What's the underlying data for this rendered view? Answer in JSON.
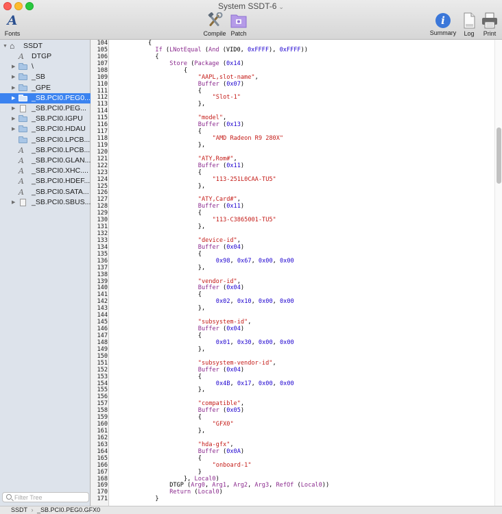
{
  "window": {
    "title": "System SSDT-6"
  },
  "toolbar": {
    "fonts_label": "Fonts",
    "compile_label": "Compile",
    "patch_label": "Patch",
    "summary_label": "Summary",
    "log_label": "Log",
    "print_label": "Print"
  },
  "sidebar": {
    "root": "SSDT",
    "items": [
      {
        "label": "DTGP",
        "icon": "method-icon",
        "disclosure": false
      },
      {
        "label": "\\",
        "icon": "folder-icon",
        "disclosure": true
      },
      {
        "label": "_SB",
        "icon": "folder-icon",
        "disclosure": true
      },
      {
        "label": "_GPE",
        "icon": "folder-icon",
        "disclosure": true
      },
      {
        "label": "_SB.PCI0.PEG0...",
        "icon": "folder-icon",
        "disclosure": true,
        "selected": true
      },
      {
        "label": "_SB.PCI0.PEG...",
        "icon": "device-icon",
        "disclosure": true
      },
      {
        "label": "_SB.PCI0.IGPU",
        "icon": "folder-icon",
        "disclosure": true
      },
      {
        "label": "_SB.PCI0.HDAU",
        "icon": "folder-icon",
        "disclosure": true
      },
      {
        "label": "_SB.PCI0.LPCB...",
        "icon": "folder-icon",
        "disclosure": false
      },
      {
        "label": "_SB.PCI0.LPCB...",
        "icon": "method-icon",
        "disclosure": false
      },
      {
        "label": "_SB.PCI0.GLAN...",
        "icon": "method-icon",
        "disclosure": false
      },
      {
        "label": "_SB.PCI0.XHC....",
        "icon": "method-icon",
        "disclosure": false
      },
      {
        "label": "_SB.PCI0.HDEF...",
        "icon": "method-icon",
        "disclosure": false
      },
      {
        "label": "_SB.PCI0.SATA...",
        "icon": "method-icon",
        "disclosure": false
      },
      {
        "label": "_SB.PCI0.SBUS...",
        "icon": "device-icon",
        "disclosure": true
      }
    ],
    "filter_placeholder": "Filter Tree"
  },
  "editor": {
    "lines": [
      {
        "n": "104",
        "indent": 10,
        "tokens": [
          [
            "p",
            "{"
          ]
        ]
      },
      {
        "n": "105",
        "indent": 12,
        "tokens": [
          [
            "k",
            "If"
          ],
          [
            "p",
            " ("
          ],
          [
            "k",
            "LNotEqual"
          ],
          [
            "p",
            " ("
          ],
          [
            "k",
            "And"
          ],
          [
            "p",
            " (VID0, "
          ],
          [
            "n",
            "0xFFFF"
          ],
          [
            "p",
            "), "
          ],
          [
            "n",
            "0xFFFF"
          ],
          [
            "p",
            "))"
          ]
        ]
      },
      {
        "n": "106",
        "indent": 12,
        "tokens": [
          [
            "p",
            "{"
          ]
        ]
      },
      {
        "n": "107",
        "indent": 16,
        "tokens": [
          [
            "k",
            "Store"
          ],
          [
            "p",
            " ("
          ],
          [
            "k",
            "Package"
          ],
          [
            "p",
            " ("
          ],
          [
            "n",
            "0x14"
          ],
          [
            "p",
            ")"
          ]
        ]
      },
      {
        "n": "108",
        "indent": 20,
        "tokens": [
          [
            "p",
            "{"
          ]
        ]
      },
      {
        "n": "109",
        "indent": 24,
        "tokens": [
          [
            "s",
            "\"AAPL,slot-name\""
          ],
          [
            "p",
            ","
          ]
        ]
      },
      {
        "n": "110",
        "indent": 24,
        "tokens": [
          [
            "k",
            "Buffer"
          ],
          [
            "p",
            " ("
          ],
          [
            "n",
            "0x07"
          ],
          [
            "p",
            ")"
          ]
        ]
      },
      {
        "n": "111",
        "indent": 24,
        "tokens": [
          [
            "p",
            "{"
          ]
        ]
      },
      {
        "n": "112",
        "indent": 28,
        "tokens": [
          [
            "s",
            "\"Slot-1\""
          ]
        ]
      },
      {
        "n": "113",
        "indent": 24,
        "tokens": [
          [
            "p",
            "},"
          ]
        ]
      },
      {
        "n": "114",
        "indent": 0,
        "tokens": []
      },
      {
        "n": "115",
        "indent": 24,
        "tokens": [
          [
            "s",
            "\"model\""
          ],
          [
            "p",
            ","
          ]
        ]
      },
      {
        "n": "116",
        "indent": 24,
        "tokens": [
          [
            "k",
            "Buffer"
          ],
          [
            "p",
            " ("
          ],
          [
            "n",
            "0x13"
          ],
          [
            "p",
            ")"
          ]
        ]
      },
      {
        "n": "117",
        "indent": 24,
        "tokens": [
          [
            "p",
            "{"
          ]
        ]
      },
      {
        "n": "118",
        "indent": 28,
        "tokens": [
          [
            "s",
            "\"AMD Radeon R9 280X\""
          ]
        ]
      },
      {
        "n": "119",
        "indent": 24,
        "tokens": [
          [
            "p",
            "},"
          ]
        ]
      },
      {
        "n": "120",
        "indent": 0,
        "tokens": []
      },
      {
        "n": "121",
        "indent": 24,
        "tokens": [
          [
            "s",
            "\"ATY,Rom#\""
          ],
          [
            "p",
            ","
          ]
        ]
      },
      {
        "n": "122",
        "indent": 24,
        "tokens": [
          [
            "k",
            "Buffer"
          ],
          [
            "p",
            " ("
          ],
          [
            "n",
            "0x11"
          ],
          [
            "p",
            ")"
          ]
        ]
      },
      {
        "n": "123",
        "indent": 24,
        "tokens": [
          [
            "p",
            "{"
          ]
        ]
      },
      {
        "n": "124",
        "indent": 28,
        "tokens": [
          [
            "s",
            "\"113-251L0CAA-TU5\""
          ]
        ]
      },
      {
        "n": "125",
        "indent": 24,
        "tokens": [
          [
            "p",
            "},"
          ]
        ]
      },
      {
        "n": "126",
        "indent": 0,
        "tokens": []
      },
      {
        "n": "127",
        "indent": 24,
        "tokens": [
          [
            "s",
            "\"ATY,Card#\""
          ],
          [
            "p",
            ","
          ]
        ]
      },
      {
        "n": "128",
        "indent": 24,
        "tokens": [
          [
            "k",
            "Buffer"
          ],
          [
            "p",
            " ("
          ],
          [
            "n",
            "0x11"
          ],
          [
            "p",
            ")"
          ]
        ]
      },
      {
        "n": "129",
        "indent": 24,
        "tokens": [
          [
            "p",
            "{"
          ]
        ]
      },
      {
        "n": "130",
        "indent": 28,
        "tokens": [
          [
            "s",
            "\"113-C3865001-TU5\""
          ]
        ]
      },
      {
        "n": "131",
        "indent": 24,
        "tokens": [
          [
            "p",
            "},"
          ]
        ]
      },
      {
        "n": "132",
        "indent": 0,
        "tokens": []
      },
      {
        "n": "133",
        "indent": 24,
        "tokens": [
          [
            "s",
            "\"device-id\""
          ],
          [
            "p",
            ","
          ]
        ]
      },
      {
        "n": "134",
        "indent": 24,
        "tokens": [
          [
            "k",
            "Buffer"
          ],
          [
            "p",
            " ("
          ],
          [
            "n",
            "0x04"
          ],
          [
            "p",
            ")"
          ]
        ]
      },
      {
        "n": "135",
        "indent": 24,
        "tokens": [
          [
            "p",
            "{"
          ]
        ]
      },
      {
        "n": "136",
        "indent": 29,
        "tokens": [
          [
            "n",
            "0x98"
          ],
          [
            "p",
            ", "
          ],
          [
            "n",
            "0x67"
          ],
          [
            "p",
            ", "
          ],
          [
            "n",
            "0x00"
          ],
          [
            "p",
            ", "
          ],
          [
            "n",
            "0x00"
          ]
        ]
      },
      {
        "n": "137",
        "indent": 24,
        "tokens": [
          [
            "p",
            "},"
          ]
        ]
      },
      {
        "n": "138",
        "indent": 0,
        "tokens": []
      },
      {
        "n": "139",
        "indent": 24,
        "tokens": [
          [
            "s",
            "\"vendor-id\""
          ],
          [
            "p",
            ","
          ]
        ]
      },
      {
        "n": "140",
        "indent": 24,
        "tokens": [
          [
            "k",
            "Buffer"
          ],
          [
            "p",
            " ("
          ],
          [
            "n",
            "0x04"
          ],
          [
            "p",
            ")"
          ]
        ]
      },
      {
        "n": "141",
        "indent": 24,
        "tokens": [
          [
            "p",
            "{"
          ]
        ]
      },
      {
        "n": "142",
        "indent": 29,
        "tokens": [
          [
            "n",
            "0x02"
          ],
          [
            "p",
            ", "
          ],
          [
            "n",
            "0x10"
          ],
          [
            "p",
            ", "
          ],
          [
            "n",
            "0x00"
          ],
          [
            "p",
            ", "
          ],
          [
            "n",
            "0x00"
          ]
        ]
      },
      {
        "n": "143",
        "indent": 24,
        "tokens": [
          [
            "p",
            "},"
          ]
        ]
      },
      {
        "n": "144",
        "indent": 0,
        "tokens": []
      },
      {
        "n": "145",
        "indent": 24,
        "tokens": [
          [
            "s",
            "\"subsystem-id\""
          ],
          [
            "p",
            ","
          ]
        ]
      },
      {
        "n": "146",
        "indent": 24,
        "tokens": [
          [
            "k",
            "Buffer"
          ],
          [
            "p",
            " ("
          ],
          [
            "n",
            "0x04"
          ],
          [
            "p",
            ")"
          ]
        ]
      },
      {
        "n": "147",
        "indent": 24,
        "tokens": [
          [
            "p",
            "{"
          ]
        ]
      },
      {
        "n": "148",
        "indent": 29,
        "tokens": [
          [
            "n",
            "0x01"
          ],
          [
            "p",
            ", "
          ],
          [
            "n",
            "0x30"
          ],
          [
            "p",
            ", "
          ],
          [
            "n",
            "0x00"
          ],
          [
            "p",
            ", "
          ],
          [
            "n",
            "0x00"
          ]
        ]
      },
      {
        "n": "149",
        "indent": 24,
        "tokens": [
          [
            "p",
            "},"
          ]
        ]
      },
      {
        "n": "150",
        "indent": 0,
        "tokens": []
      },
      {
        "n": "151",
        "indent": 24,
        "tokens": [
          [
            "s",
            "\"subsystem-vendor-id\""
          ],
          [
            "p",
            ","
          ]
        ]
      },
      {
        "n": "152",
        "indent": 24,
        "tokens": [
          [
            "k",
            "Buffer"
          ],
          [
            "p",
            " ("
          ],
          [
            "n",
            "0x04"
          ],
          [
            "p",
            ")"
          ]
        ]
      },
      {
        "n": "153",
        "indent": 24,
        "tokens": [
          [
            "p",
            "{"
          ]
        ]
      },
      {
        "n": "154",
        "indent": 29,
        "tokens": [
          [
            "n",
            "0x4B"
          ],
          [
            "p",
            ", "
          ],
          [
            "n",
            "0x17"
          ],
          [
            "p",
            ", "
          ],
          [
            "n",
            "0x00"
          ],
          [
            "p",
            ", "
          ],
          [
            "n",
            "0x00"
          ]
        ]
      },
      {
        "n": "155",
        "indent": 24,
        "tokens": [
          [
            "p",
            "},"
          ]
        ]
      },
      {
        "n": "156",
        "indent": 0,
        "tokens": []
      },
      {
        "n": "157",
        "indent": 24,
        "tokens": [
          [
            "s",
            "\"compatible\""
          ],
          [
            "p",
            ","
          ]
        ]
      },
      {
        "n": "158",
        "indent": 24,
        "tokens": [
          [
            "k",
            "Buffer"
          ],
          [
            "p",
            " ("
          ],
          [
            "n",
            "0x05"
          ],
          [
            "p",
            ")"
          ]
        ]
      },
      {
        "n": "159",
        "indent": 24,
        "tokens": [
          [
            "p",
            "{"
          ]
        ]
      },
      {
        "n": "160",
        "indent": 28,
        "tokens": [
          [
            "s",
            "\"GFX0\""
          ]
        ]
      },
      {
        "n": "161",
        "indent": 24,
        "tokens": [
          [
            "p",
            "},"
          ]
        ]
      },
      {
        "n": "162",
        "indent": 0,
        "tokens": []
      },
      {
        "n": "163",
        "indent": 24,
        "tokens": [
          [
            "s",
            "\"hda-gfx\""
          ],
          [
            "p",
            ","
          ]
        ]
      },
      {
        "n": "164",
        "indent": 24,
        "tokens": [
          [
            "k",
            "Buffer"
          ],
          [
            "p",
            " ("
          ],
          [
            "n",
            "0x0A"
          ],
          [
            "p",
            ")"
          ]
        ]
      },
      {
        "n": "165",
        "indent": 24,
        "tokens": [
          [
            "p",
            "{"
          ]
        ]
      },
      {
        "n": "166",
        "indent": 28,
        "tokens": [
          [
            "s",
            "\"onboard-1\""
          ]
        ]
      },
      {
        "n": "167",
        "indent": 24,
        "tokens": [
          [
            "p",
            "}"
          ]
        ]
      },
      {
        "n": "168",
        "indent": 20,
        "tokens": [
          [
            "p",
            "}, "
          ],
          [
            "k",
            "Local0"
          ],
          [
            "p",
            ")"
          ]
        ]
      },
      {
        "n": "169",
        "indent": 16,
        "tokens": [
          [
            "p",
            "DTGP ("
          ],
          [
            "k",
            "Arg0"
          ],
          [
            "p",
            ", "
          ],
          [
            "k",
            "Arg1"
          ],
          [
            "p",
            ", "
          ],
          [
            "k",
            "Arg2"
          ],
          [
            "p",
            ", "
          ],
          [
            "k",
            "Arg3"
          ],
          [
            "p",
            ", "
          ],
          [
            "k",
            "RefOf"
          ],
          [
            "p",
            " ("
          ],
          [
            "k",
            "Local0"
          ],
          [
            "p",
            "))"
          ]
        ]
      },
      {
        "n": "170",
        "indent": 16,
        "tokens": [
          [
            "k",
            "Return"
          ],
          [
            "p",
            " ("
          ],
          [
            "k",
            "Local0"
          ],
          [
            "p",
            ")"
          ]
        ]
      },
      {
        "n": "171",
        "indent": 12,
        "tokens": [
          [
            "p",
            "}"
          ]
        ]
      }
    ]
  },
  "statusbar": {
    "path": [
      "SSDT",
      "›",
      "_SB.PCI0.PEG0.GFX0"
    ]
  },
  "colors": {
    "keyword": "#8b2a8e",
    "string": "#c41a16",
    "number": "#1c00cf",
    "selection": "#3b83f0",
    "sidebar_bg": "#dde3eb"
  }
}
